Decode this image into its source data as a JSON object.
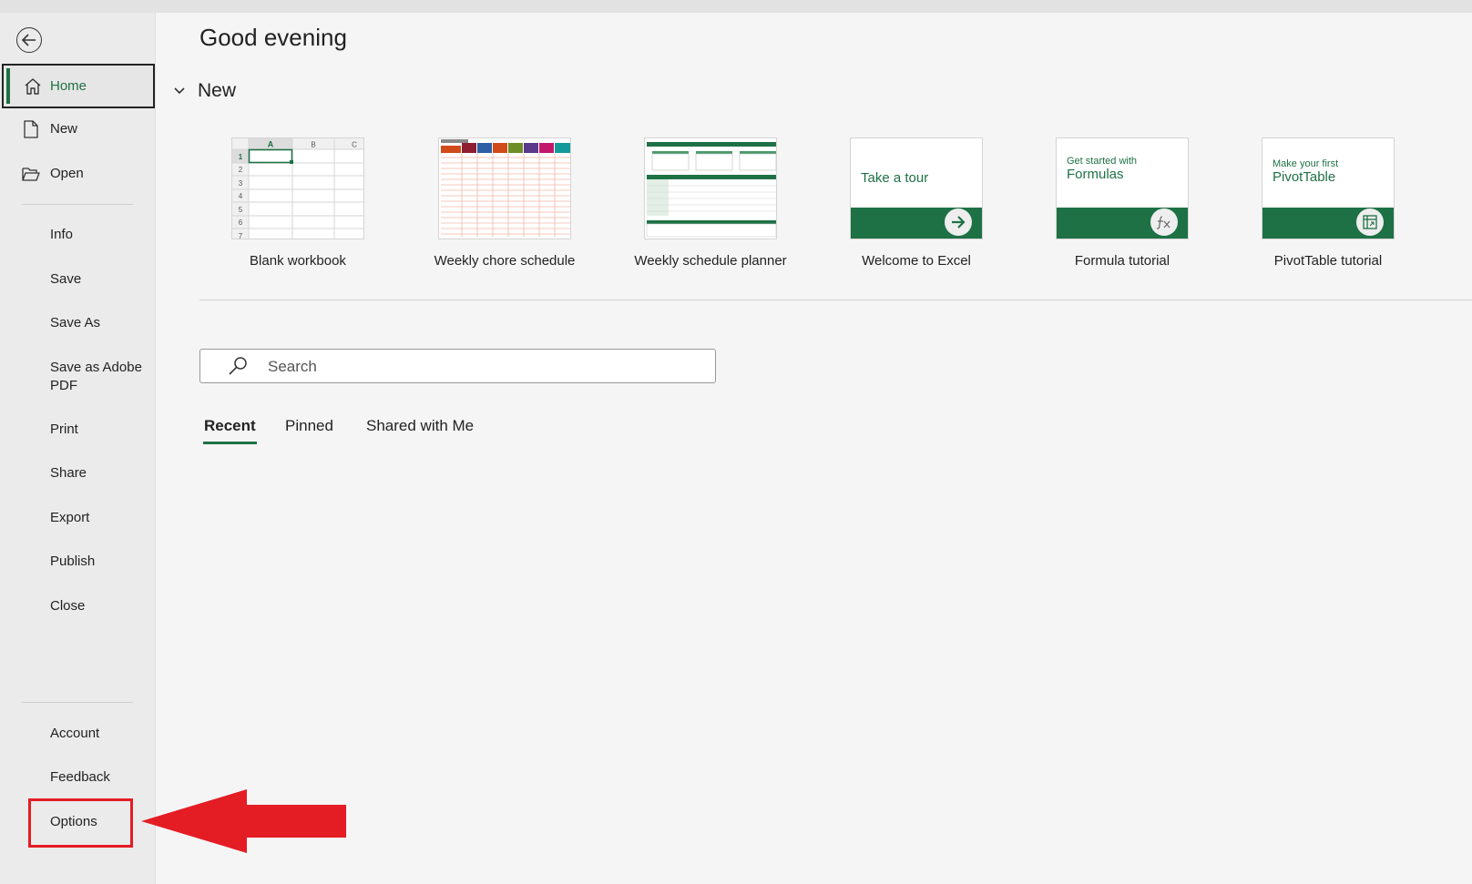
{
  "sidebar": {
    "home": "Home",
    "new": "New",
    "open": "Open",
    "info": "Info",
    "save": "Save",
    "save_as": "Save As",
    "save_pdf_line1": "Save as Adobe",
    "save_pdf_line2": "PDF",
    "print": "Print",
    "share": "Share",
    "export": "Export",
    "publish": "Publish",
    "close": "Close",
    "account": "Account",
    "feedback": "Feedback",
    "options": "Options"
  },
  "main": {
    "greeting": "Good evening",
    "new_section": "New",
    "templates": [
      {
        "label": "Blank workbook"
      },
      {
        "label": "Weekly chore schedule"
      },
      {
        "label": "Weekly schedule planner"
      },
      {
        "label": "Welcome to Excel",
        "thumb_text": "Take a tour"
      },
      {
        "label": "Formula tutorial",
        "thumb_line1": "Get started with",
        "thumb_line2": "Formulas"
      },
      {
        "label": "PivotTable tutorial",
        "thumb_line1": "Make your first",
        "thumb_line2": "PivotTable"
      }
    ],
    "blank": {
      "cols": [
        "A",
        "B",
        "C"
      ],
      "rows": [
        "1",
        "2",
        "3",
        "4",
        "5",
        "6",
        "7"
      ]
    },
    "search": {
      "placeholder": "Search"
    },
    "tabs": [
      "Recent",
      "Pinned",
      "Shared with Me"
    ]
  },
  "colors": {
    "excel_green": "#1e7145",
    "highlight_red": "#e41c24"
  },
  "icons": {
    "back": "back-arrow-icon",
    "home": "home-icon",
    "new": "new-document-icon",
    "open": "open-folder-icon",
    "search": "search-icon",
    "chevron": "chevron-down-icon"
  }
}
